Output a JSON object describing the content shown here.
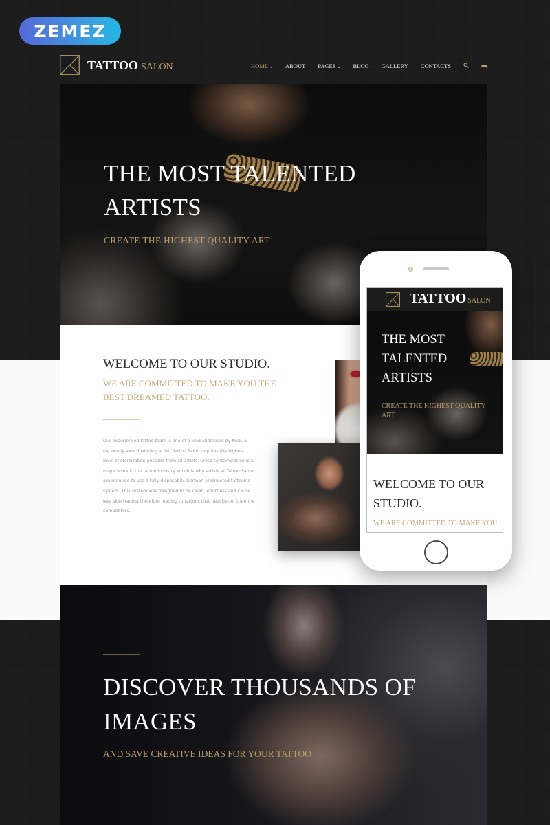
{
  "badge": {
    "label": "ZEMEZ"
  },
  "header": {
    "logo_primary": "TATTOO",
    "logo_secondary": "SALON",
    "nav": [
      {
        "label": "HOME",
        "has_dropdown": true,
        "active": true
      },
      {
        "label": "ABOUT",
        "has_dropdown": false
      },
      {
        "label": "PAGES",
        "has_dropdown": true
      },
      {
        "label": "BLOG",
        "has_dropdown": false
      },
      {
        "label": "GALLERY",
        "has_dropdown": false
      },
      {
        "label": "CONTACTS",
        "has_dropdown": false
      }
    ],
    "caret": "⌄",
    "icons": {
      "search": "search-icon",
      "key": "key-icon"
    }
  },
  "hero": {
    "title": "THE MOST TALENTED ARTISTS",
    "subtitle": "CREATE THE HIGHEST QUALITY ART"
  },
  "welcome": {
    "title": "WELCOME TO OUR STUDIO.",
    "subtitle": "WE ARE COMMITTED TO MAKE YOU THE BEST DREAMED TATTOO.",
    "body": "Our experienced tattoo team is one of a kind all trained by Nick, a nationally award winning artist. Tattoo Salon requires the highest level of sterilization possible from all artists. Cross contamination is a major issue in the tattoo industry which is why artists at Tattoo Salon are required to use a fully disposable, German engineered tattooing system. This system was designed to be clean, effortless and cause less skin trauma therefore leading to tattoos that heal better than the competitors."
  },
  "discover": {
    "title": "DISCOVER THOUSANDS OF IMAGES",
    "subtitle": "AND SAVE CREATIVE IDEAS FOR YOUR TATTOO"
  },
  "phone": {
    "logo_primary": "TATTOO",
    "logo_secondary": "SALON",
    "hero_title": "THE MOST TALENTED ARTISTS",
    "hero_subtitle": "CREATE THE HIGHEST QUALITY ART",
    "welcome_title": "WELCOME TO OUR STUDIO.",
    "welcome_subtitle": "WE ARE COMMITTED TO MAKE YOU"
  },
  "colors": {
    "accent_gold": "#b79f6b",
    "accent_gold_light": "#c3ab7c",
    "background_dark": "#1b1b1b",
    "badge_gradient_start": "#5568d8",
    "badge_gradient_end": "#22b8e0"
  }
}
